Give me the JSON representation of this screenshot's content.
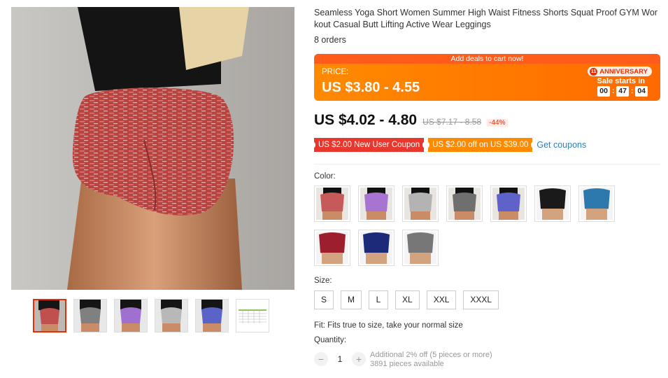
{
  "product": {
    "title": "Seamless Yoga Short Women Summer High Waist Fitness Shorts Squat Proof GYM Workout Casual Butt Lifting Active Wear Leggings",
    "orders": "8 orders"
  },
  "deal": {
    "strip": "Add deals to cart now!",
    "price_label": "PRICE:",
    "price": "US $3.80 - 4.55",
    "badge": "ANNIVERSARY",
    "sale_starts": "Sale starts in",
    "timer": [
      "00",
      "47",
      "04"
    ]
  },
  "pricing": {
    "price": "US $4.02 - 4.80",
    "old_price": "US $7.17 - 8.58",
    "discount": "-44%"
  },
  "coupons": {
    "new_user": "US $2.00 New User Coupon",
    "off": "US $2.00 off on US $39.00",
    "get": "Get coupons"
  },
  "color": {
    "label": "Color:",
    "options": [
      "pink-red",
      "purple",
      "grey",
      "dark-grey",
      "blue",
      "black",
      "solid-blue",
      "wine-red",
      "navy",
      "solid-grey"
    ]
  },
  "size": {
    "label": "Size:",
    "options": [
      "S",
      "M",
      "L",
      "XL",
      "XXL",
      "XXXL"
    ]
  },
  "fit": "Fit: Fits true to size, take your normal size",
  "quantity": {
    "label": "Quantity:",
    "value": "1",
    "minus": "−",
    "plus": "+",
    "note1": "Additional 2% off (5 pieces or more)",
    "note2": "3891 pieces available"
  },
  "colors": {
    "accent": "#e62e04",
    "deal_orange": "#ff7a00",
    "link": "#2e7fb8"
  }
}
